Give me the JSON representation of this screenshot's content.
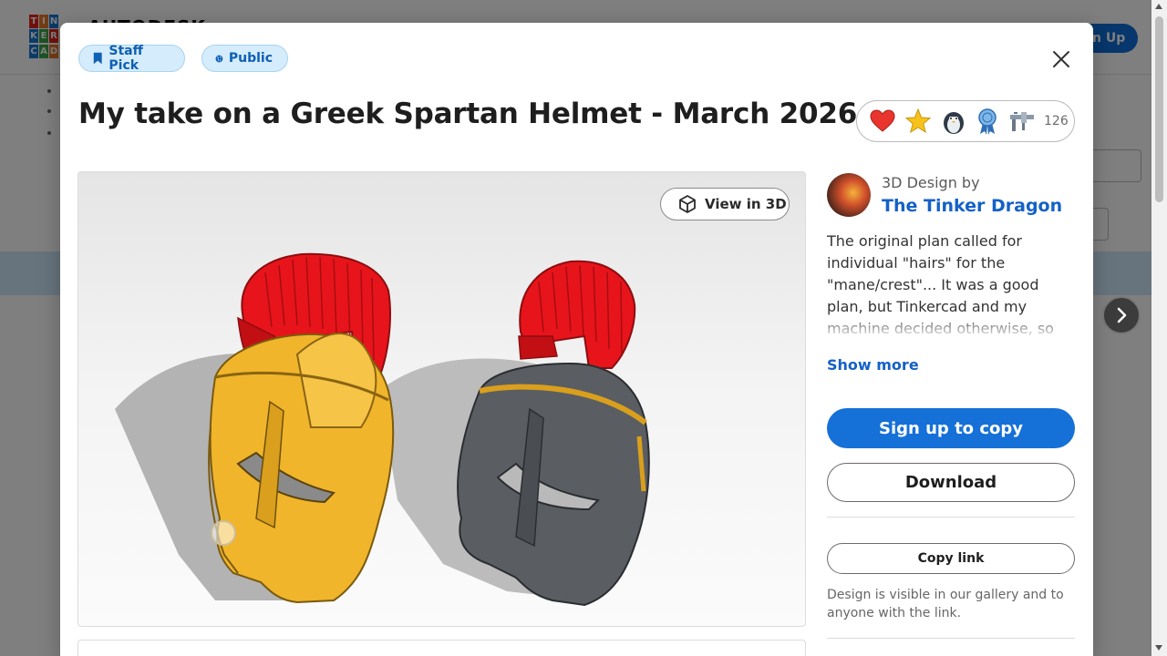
{
  "background": {
    "logo_letters": [
      "T",
      "I",
      "N",
      "K",
      "E",
      "R",
      "C",
      "A",
      "D"
    ],
    "brand": "AUTODESK",
    "signup_label": "n Up"
  },
  "modal": {
    "badges": [
      {
        "label": "Staff Pick",
        "icon": "bookmark-icon"
      },
      {
        "label": "Public",
        "icon": "globe-icon"
      }
    ],
    "title": "My take on a Greek Spartan Helmet - March 2026",
    "reactions": {
      "icons": [
        "heart-icon",
        "star-icon",
        "penguin-icon",
        "ribbon-icon",
        "caliper-icon"
      ],
      "count": "126"
    },
    "viewer": {
      "view3d_label": "View in 3D"
    },
    "author": {
      "by_label": "3D Design by",
      "name": "The Tinker Dragon"
    },
    "description": "The original plan called for individual \"hairs\" for the \"mane/crest\"... It was a good plan, but Tinkercad and my machine decided otherwise, so plan B. If you",
    "show_more": "Show more",
    "actions": {
      "primary": "Sign up to copy",
      "download": "Download",
      "copy_link": "Copy link"
    },
    "visibility_note": "Design is visible in our gallery and to anyone with the link."
  },
  "colors": {
    "accent": "#1570d8",
    "link": "#1461c7",
    "badge_bg": "#d4ecfb",
    "helmet_gold": "#f0b52b",
    "helmet_dark": "#5a5e63",
    "crest_red": "#e8141b"
  }
}
